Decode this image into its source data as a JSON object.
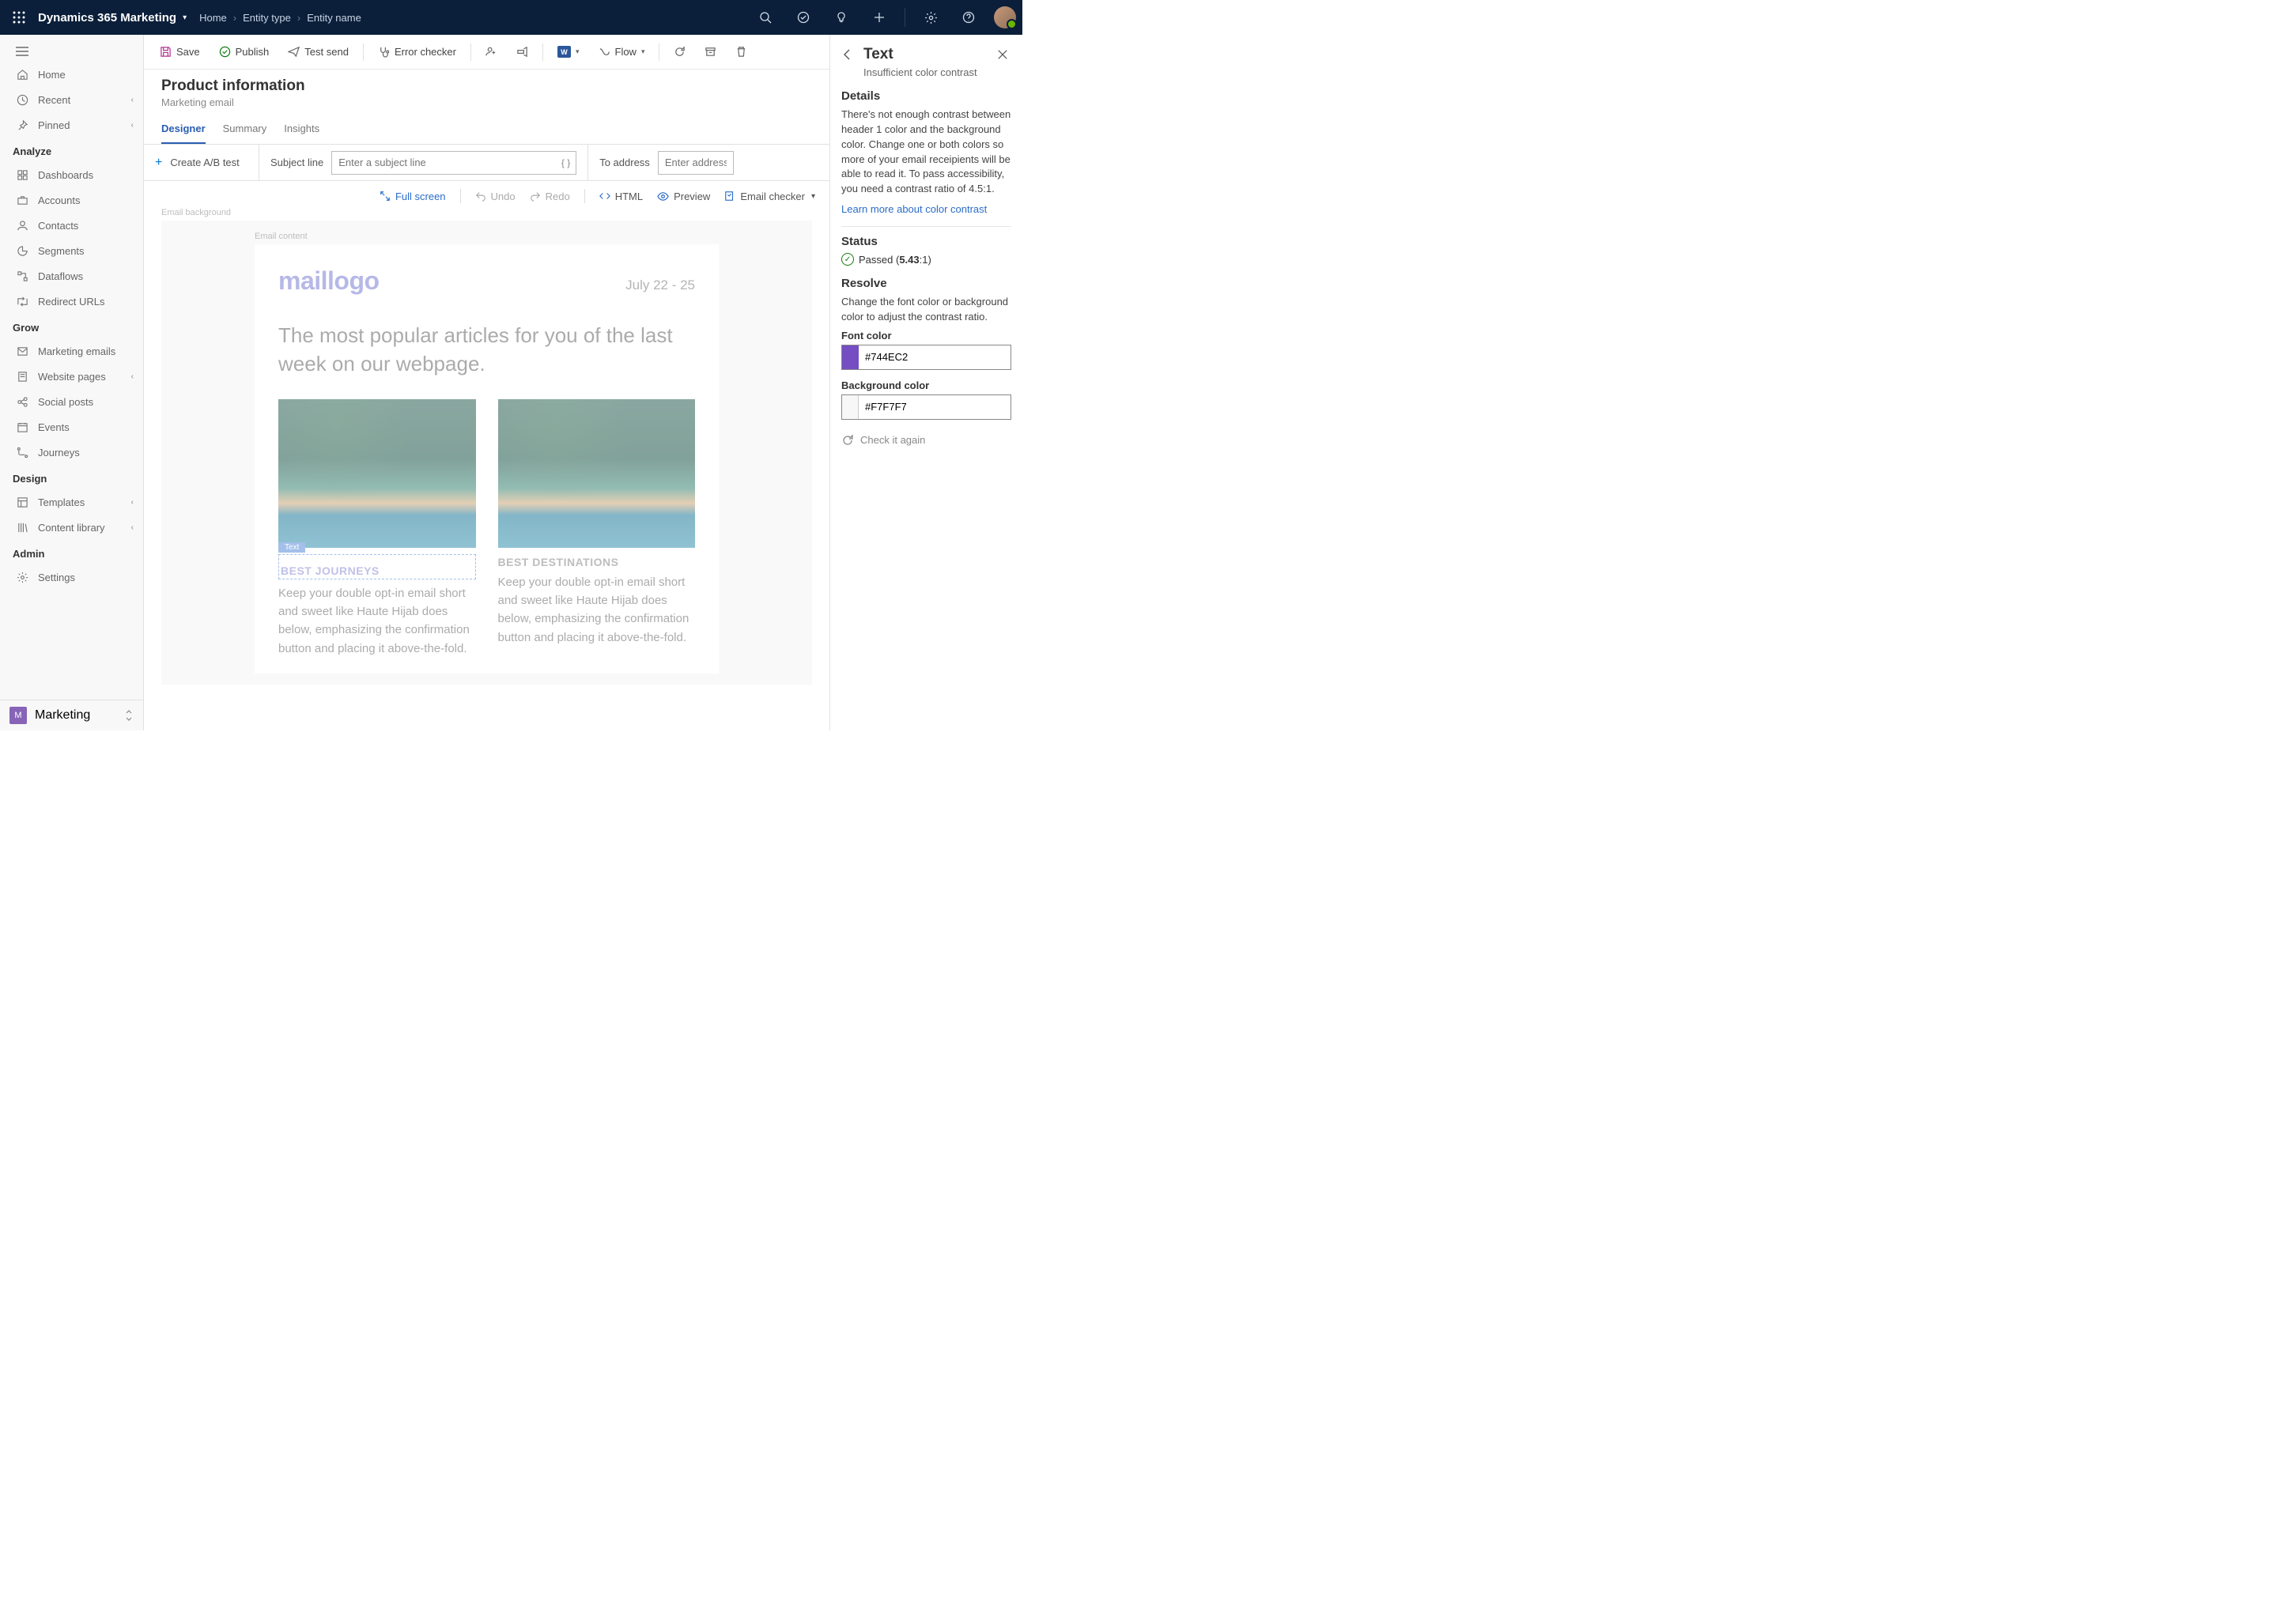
{
  "topbar": {
    "appName": "Dynamics 365 Marketing",
    "breadcrumb": [
      "Home",
      "Entity type",
      "Entity name"
    ]
  },
  "sidebar": {
    "top": [
      {
        "icon": "home",
        "label": "Home"
      },
      {
        "icon": "clock",
        "label": "Recent",
        "chev": true
      },
      {
        "icon": "pin",
        "label": "Pinned",
        "chev": true
      }
    ],
    "groups": [
      {
        "label": "Analyze",
        "items": [
          {
            "icon": "dashboard",
            "label": "Dashboards"
          },
          {
            "icon": "briefcase",
            "label": "Accounts"
          },
          {
            "icon": "person",
            "label": "Contacts"
          },
          {
            "icon": "segments",
            "label": "Segments"
          },
          {
            "icon": "dataflow",
            "label": "Dataflows"
          },
          {
            "icon": "redirect",
            "label": "Redirect URLs"
          }
        ]
      },
      {
        "label": "Grow",
        "items": [
          {
            "icon": "mail",
            "label": "Marketing emails"
          },
          {
            "icon": "page",
            "label": "Website pages",
            "chev": true
          },
          {
            "icon": "social",
            "label": "Social posts"
          },
          {
            "icon": "calendar",
            "label": "Events"
          },
          {
            "icon": "journey",
            "label": "Journeys"
          }
        ]
      },
      {
        "label": "Design",
        "items": [
          {
            "icon": "template",
            "label": "Templates",
            "chev": true
          },
          {
            "icon": "library",
            "label": "Content library",
            "chev": true
          }
        ]
      },
      {
        "label": "Admin",
        "items": [
          {
            "icon": "gear",
            "label": "Settings"
          }
        ]
      }
    ],
    "footerLetter": "M",
    "footerLabel": "Marketing"
  },
  "commandbar": {
    "save": "Save",
    "publish": "Publish",
    "testSend": "Test send",
    "errorChecker": "Error checker",
    "flow": "Flow"
  },
  "page": {
    "title": "Product information",
    "subtitle": "Marketing email",
    "tabs": [
      "Designer",
      "Summary",
      "Insights"
    ],
    "activeTab": 0
  },
  "formbar": {
    "abTest": "Create A/B test",
    "subjectLabel": "Subject line",
    "subjectPlaceholder": "Enter a subject line",
    "toLabel": "To address",
    "toPlaceholder": "Enter address"
  },
  "canvasToolbar": {
    "fullScreen": "Full screen",
    "undo": "Undo",
    "redo": "Redo",
    "html": "HTML",
    "preview": "Preview",
    "emailChecker": "Email checker"
  },
  "email": {
    "bgLabel": "Email background",
    "contentLabel": "Email content",
    "logo": "maillogo",
    "date": "July 22 - 25",
    "headline": "The most popular articles for you of the last week on our webpage.",
    "textTag": "Text",
    "articles": [
      {
        "title": "BEST JOURNEYS",
        "body": "Keep your double opt-in email short and sweet like Haute Hijab does below, emphasizing the confirmation button and placing it above-the-fold."
      },
      {
        "title": "BEST DESTINATIONS",
        "body": "Keep your double opt-in email short and sweet like Haute Hijab does below, emphasizing the confirmation button and placing it above-the-fold."
      }
    ]
  },
  "panel": {
    "title": "Text",
    "subtitle": "Insufficient color contrast",
    "detailsH": "Details",
    "detailsBody": "There's not enough contrast between header 1 color and the background color. Change one or both colors so more of your email receipients will be able to read it. To pass accessibility, you need a contrast ratio of 4.5:1.",
    "learnMore": "Learn more about color contrast",
    "statusH": "Status",
    "statusPre": "Passed (",
    "statusBold": "5.43",
    "statusPost": ":1)",
    "resolveH": "Resolve",
    "resolveBody": "Change the font color or background color to adjust the contrast ratio.",
    "fontColorLabel": "Font color",
    "fontColorValue": "#744EC2",
    "bgColorLabel": "Background color",
    "bgColorValue": "#F7F7F7",
    "checkAgain": "Check it again"
  }
}
